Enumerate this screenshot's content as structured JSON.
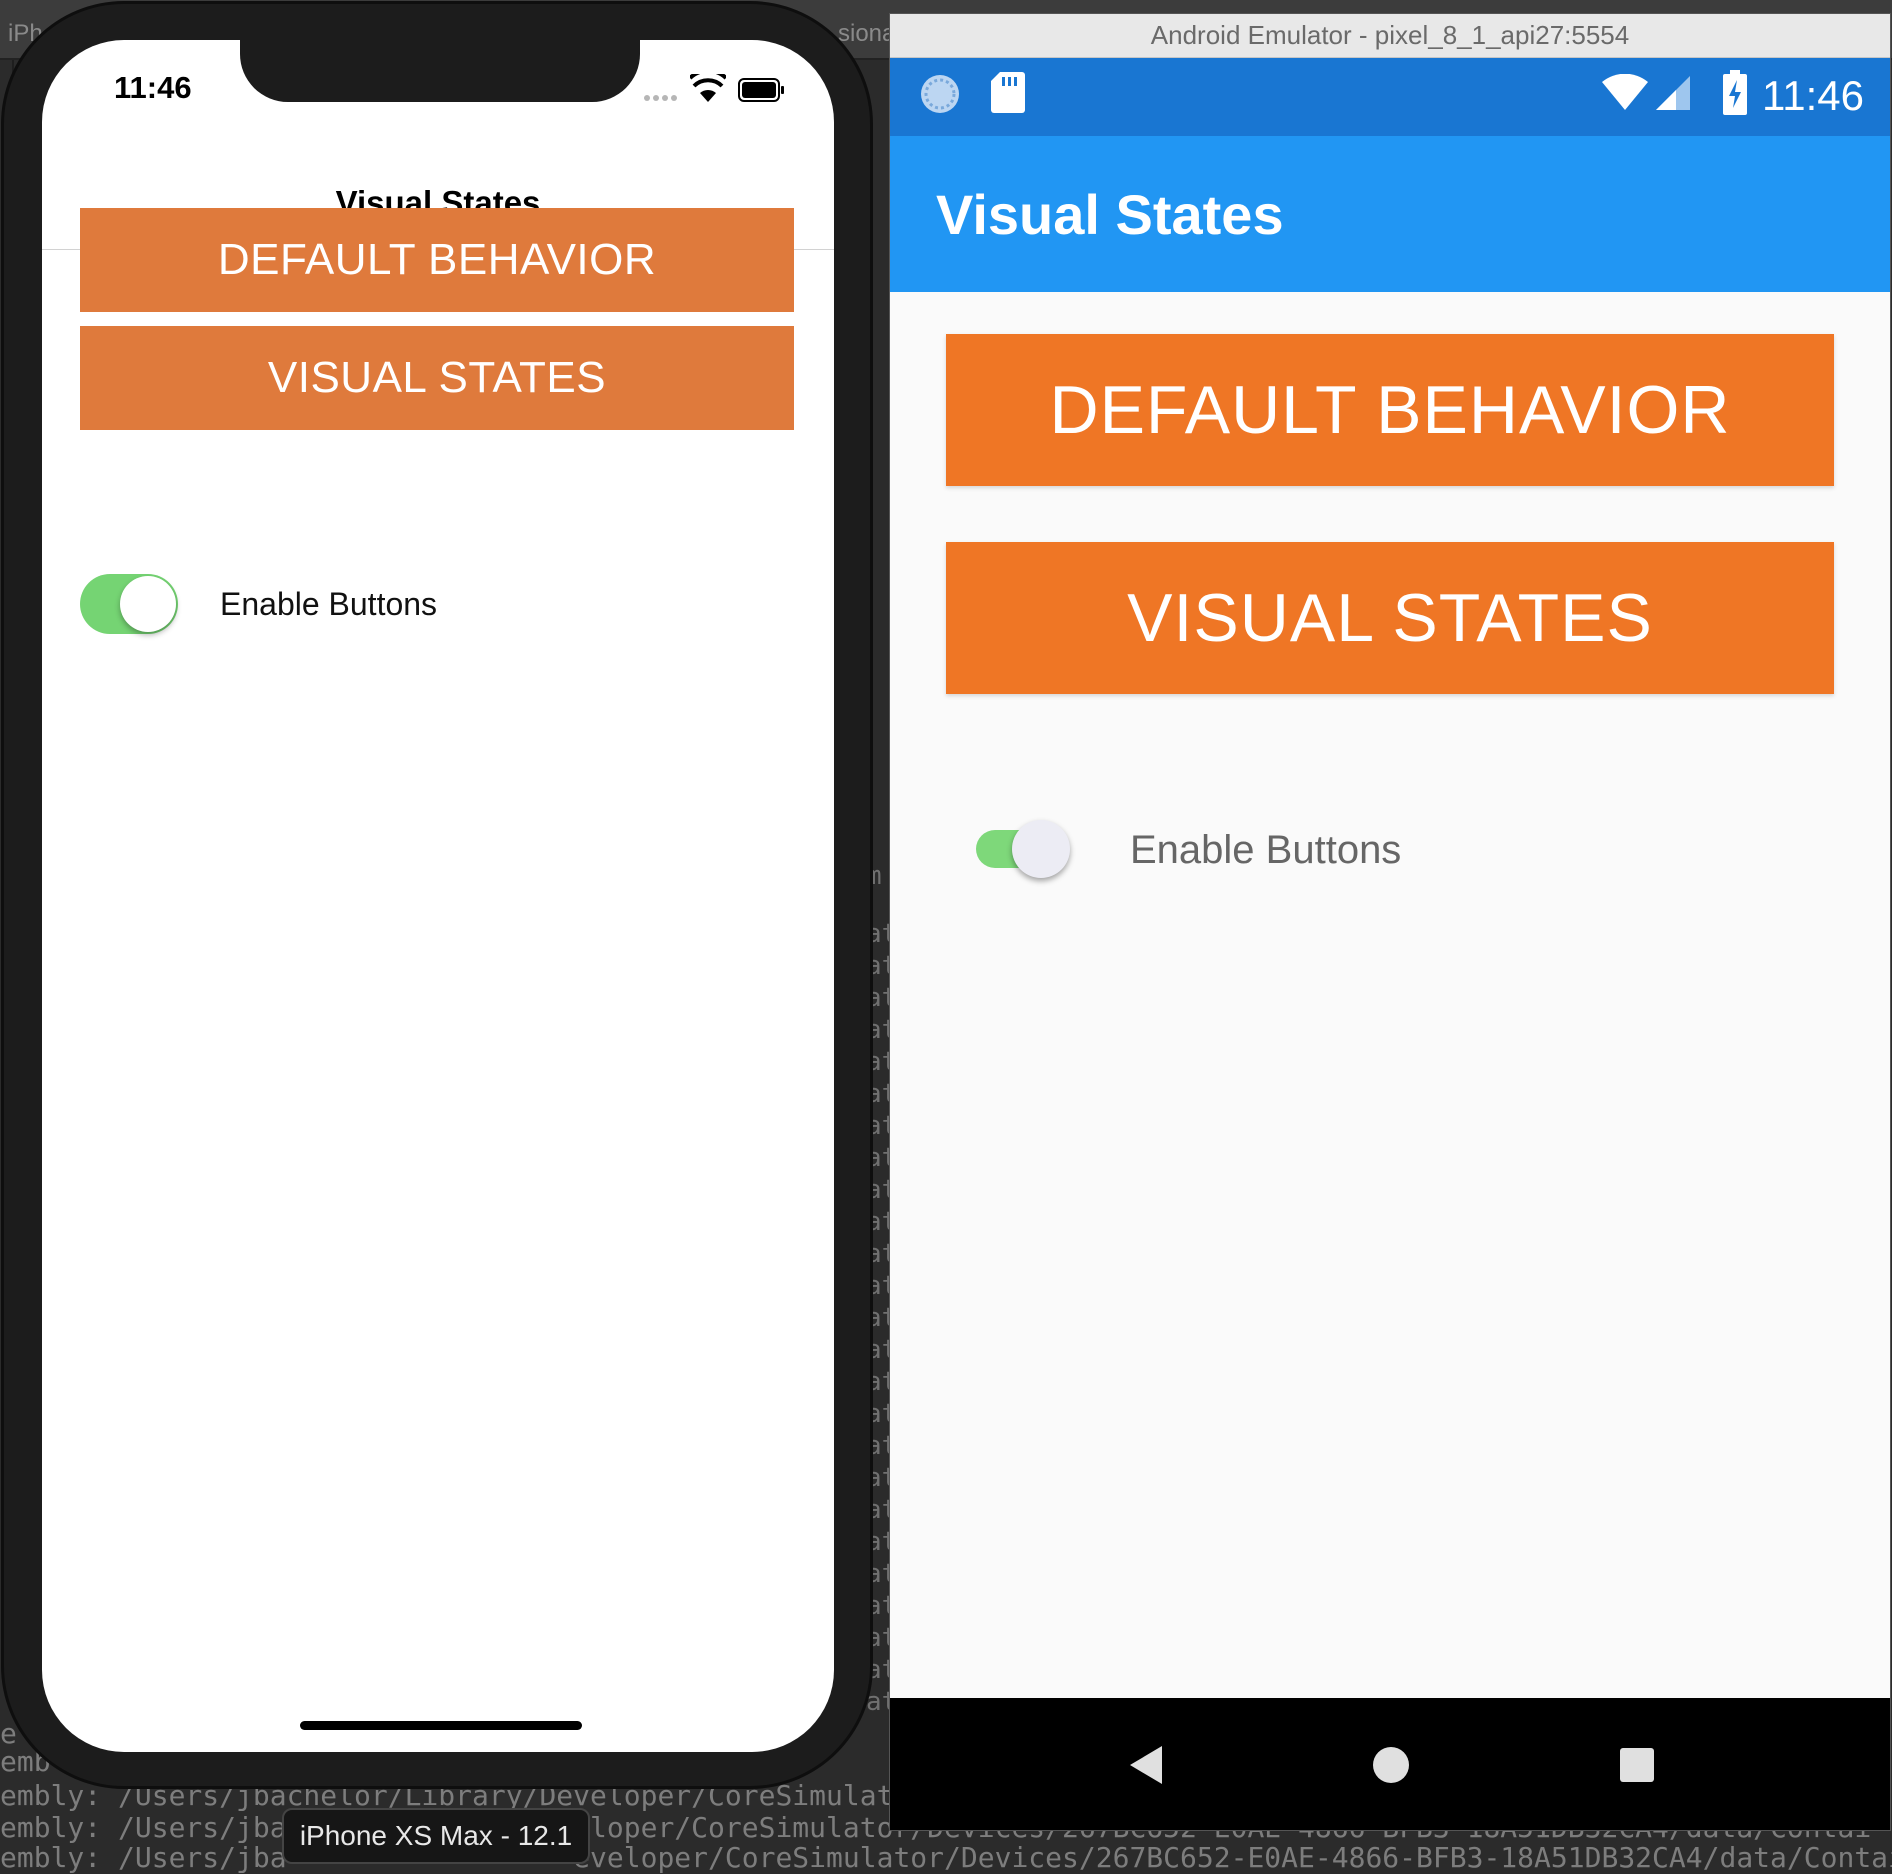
{
  "console": {
    "top_fragments": [
      "iPh",
      "siona"
    ],
    "column_char": "at",
    "side_char": "m",
    "lines": [
      "e",
      "emb",
      "embly: /Users/jbachelor/Library/Developer/CoreSimulat",
      "embly: /Users/jba                 eloper/CoreSimulator/Devices/267BC652-E0AE-4866-BFB3-18A51DB32CA4/data/Contai",
      "embly: /Users/jba                 eveloper/CoreSimulator/Devices/267BC652-E0AE-4866-BFB3-18A51DB32CA4/data/Contai"
    ],
    "right_fragments": [
      "ulat",
      "cat"
    ]
  },
  "iphone": {
    "time": "11:46",
    "nav_title": "Visual States",
    "buttons": [
      "DEFAULT BEHAVIOR",
      "VISUAL STATES"
    ],
    "toggle_label": "Enable Buttons",
    "toggle_on": true,
    "caption": "iPhone XS Max - 12.1",
    "colors": {
      "button": "#df7a3c",
      "toggle_on": "#75d473"
    }
  },
  "android": {
    "window_title": "Android Emulator - pixel_8_1_api27:5554",
    "time": "11:46",
    "app_title": "Visual States",
    "buttons": [
      "DEFAULT BEHAVIOR",
      "VISUAL STATES"
    ],
    "toggle_label": "Enable Buttons",
    "toggle_on": true,
    "colors": {
      "statusbar": "#1976d2",
      "appbar": "#2196f3",
      "button": "#ef7625",
      "toggle_on": "#7ed87a"
    },
    "status_icons": [
      "sync-icon",
      "sd-card-icon",
      "wifi-icon",
      "cell-signal-icon",
      "battery-charging-icon"
    ],
    "nav_icons": [
      "back-icon",
      "home-icon",
      "recents-icon"
    ]
  }
}
